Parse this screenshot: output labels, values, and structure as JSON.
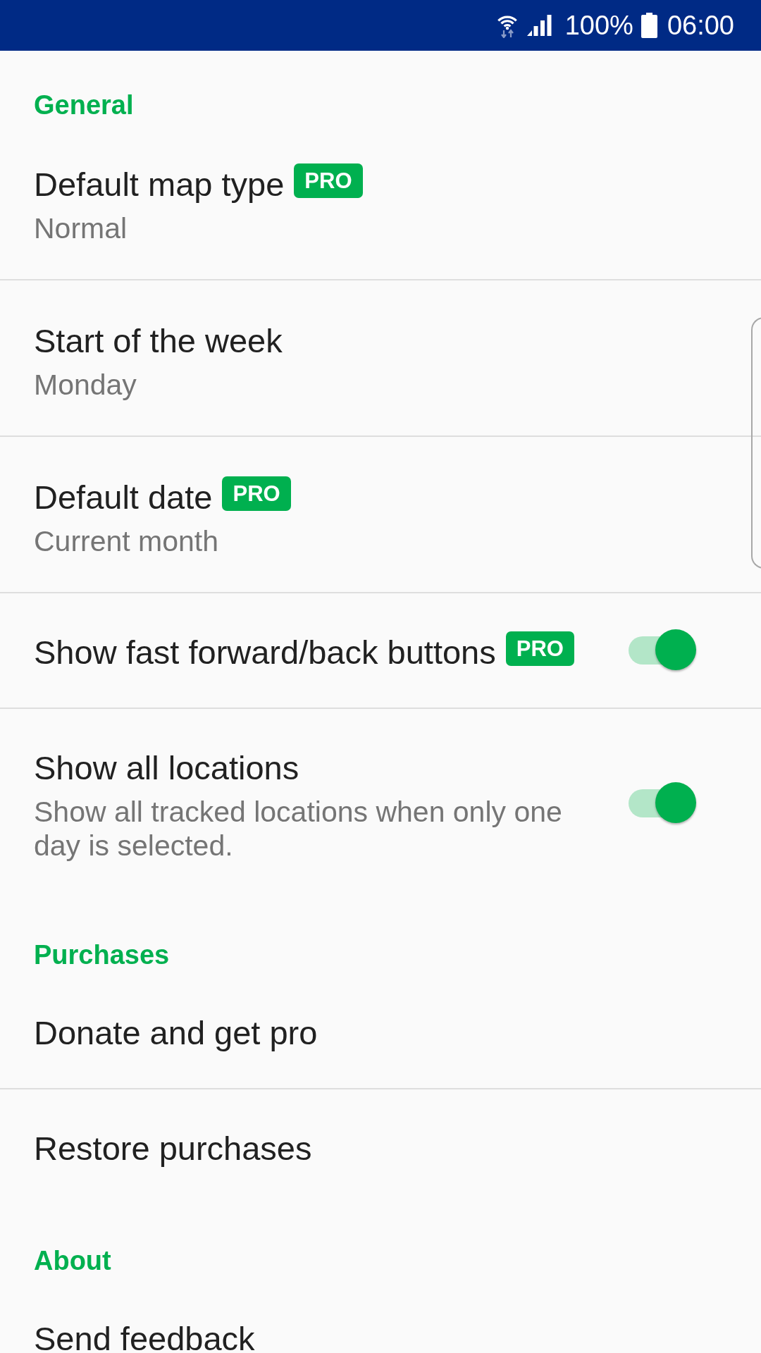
{
  "status_bar": {
    "battery": "100%",
    "time": "06:00"
  },
  "sections": [
    {
      "title": "General",
      "items": [
        {
          "kind": "value",
          "title": "Default map type",
          "badge": "PRO",
          "value": "Normal"
        },
        {
          "kind": "value",
          "title": "Start of the week",
          "value": "Monday"
        },
        {
          "kind": "value",
          "title": "Default date",
          "badge": "PRO",
          "value": "Current month"
        },
        {
          "kind": "switch",
          "title": "Show fast forward/back buttons",
          "badge": "PRO",
          "on": true
        },
        {
          "kind": "switch",
          "title": "Show all locations",
          "summary": "Show all tracked locations when only one day is selected.",
          "on": true
        }
      ]
    },
    {
      "title": "Purchases",
      "items": [
        {
          "kind": "action",
          "title": "Donate and get pro"
        },
        {
          "kind": "action",
          "title": "Restore purchases"
        }
      ]
    },
    {
      "title": "About",
      "items": [
        {
          "kind": "action",
          "title": "Send feedback"
        }
      ]
    }
  ]
}
